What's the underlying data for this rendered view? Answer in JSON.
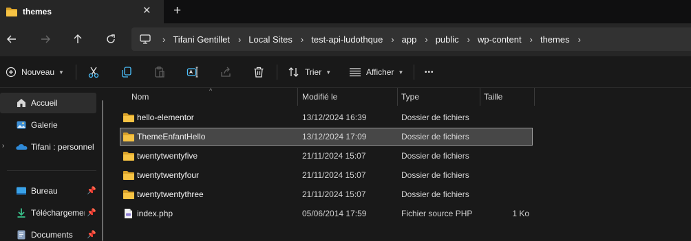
{
  "tab": {
    "title": "themes",
    "close": "✕",
    "new_tab": "+"
  },
  "nav": {
    "back": "←",
    "forward": "→",
    "up": "↑",
    "refresh": "↻"
  },
  "breadcrumbs": [
    "Tifani Gentillet",
    "Local Sites",
    "test-api-ludothque",
    "app",
    "public",
    "wp-content",
    "themes"
  ],
  "toolbar": {
    "new_label": "Nouveau",
    "sort_label": "Trier",
    "view_label": "Afficher",
    "more": "•••"
  },
  "sidebar": {
    "items": [
      {
        "label": "Accueil",
        "icon": "home-icon",
        "selected": true
      },
      {
        "label": "Galerie",
        "icon": "gallery-icon"
      },
      {
        "label": "Tifani : personnel",
        "icon": "onedrive-icon",
        "expandable": true
      },
      {
        "label": "Bureau",
        "icon": "desktop-icon",
        "pinned": true
      },
      {
        "label": "Téléchargemen",
        "icon": "downloads-icon",
        "pinned": true
      },
      {
        "label": "Documents",
        "icon": "documents-icon",
        "pinned": true
      }
    ]
  },
  "columns": {
    "name": "Nom",
    "modified": "Modifié le",
    "type": "Type",
    "size": "Taille"
  },
  "files": [
    {
      "name": "hello-elementor",
      "modified": "13/12/2024 16:39",
      "type": "Dossier de fichiers",
      "size": "",
      "kind": "folder"
    },
    {
      "name": "ThemeEnfantHello",
      "modified": "13/12/2024 17:09",
      "type": "Dossier de fichiers",
      "size": "",
      "kind": "folder",
      "selected": true
    },
    {
      "name": "twentytwentyfive",
      "modified": "21/11/2024 15:07",
      "type": "Dossier de fichiers",
      "size": "",
      "kind": "folder"
    },
    {
      "name": "twentytwentyfour",
      "modified": "21/11/2024 15:07",
      "type": "Dossier de fichiers",
      "size": "",
      "kind": "folder"
    },
    {
      "name": "twentytwentythree",
      "modified": "21/11/2024 15:07",
      "type": "Dossier de fichiers",
      "size": "",
      "kind": "folder"
    },
    {
      "name": "index.php",
      "modified": "05/06/2014 17:59",
      "type": "Fichier source PHP",
      "size": "1 Ko",
      "kind": "php"
    }
  ],
  "colors": {
    "folder": "#f6c344",
    "folder_dark": "#d9a22a",
    "accent_blue": "#4cc2ff",
    "selection": "#474747"
  }
}
